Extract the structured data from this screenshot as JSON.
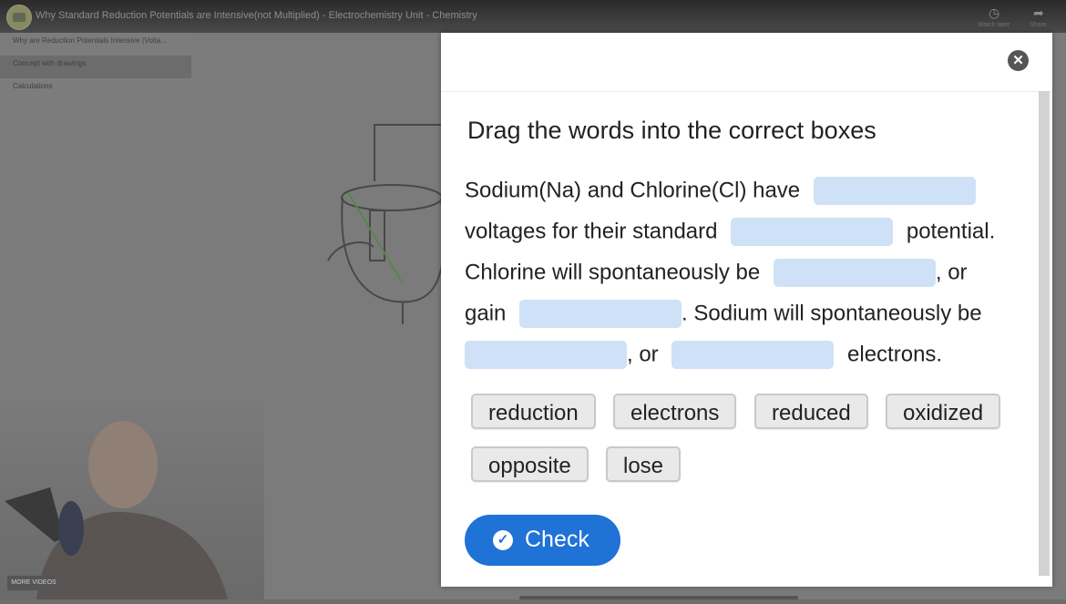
{
  "player": {
    "video_title": "Why Standard Reduction Potentials are Intensive(not Multiplied) - Electrochemistry Unit - Chemistry",
    "watch_later_label": "Watch later",
    "share_label": "Share",
    "more_videos": "MORE VIDEOS",
    "chapters": [
      "Why are Reduction Potentials Intensive (Volta...",
      "Concept with drawings",
      "Calculations"
    ]
  },
  "modal": {
    "instruction": "Drag the words into the correct boxes",
    "sentence": {
      "t1": "Sodium(Na) and Chlorine(Cl) have",
      "t2": "voltages for their standard",
      "t3": "potential.",
      "t4": "Chlorine will spontaneously be",
      "t5": ", or",
      "t6": "gain",
      "t7": ". Sodium will spontaneously be",
      "t8": ", or",
      "t9": "electrons."
    },
    "words": [
      "reduction",
      "electrons",
      "reduced",
      "oxidized",
      "opposite",
      "lose"
    ],
    "check_label": "Check"
  },
  "colors": {
    "check_button": "#1f72d6",
    "drop_zone": "#cfe1f6",
    "word_chip": "#e9e9e9"
  },
  "icons": [
    "close-icon",
    "check-circle-icon",
    "clock-icon",
    "share-icon"
  ]
}
